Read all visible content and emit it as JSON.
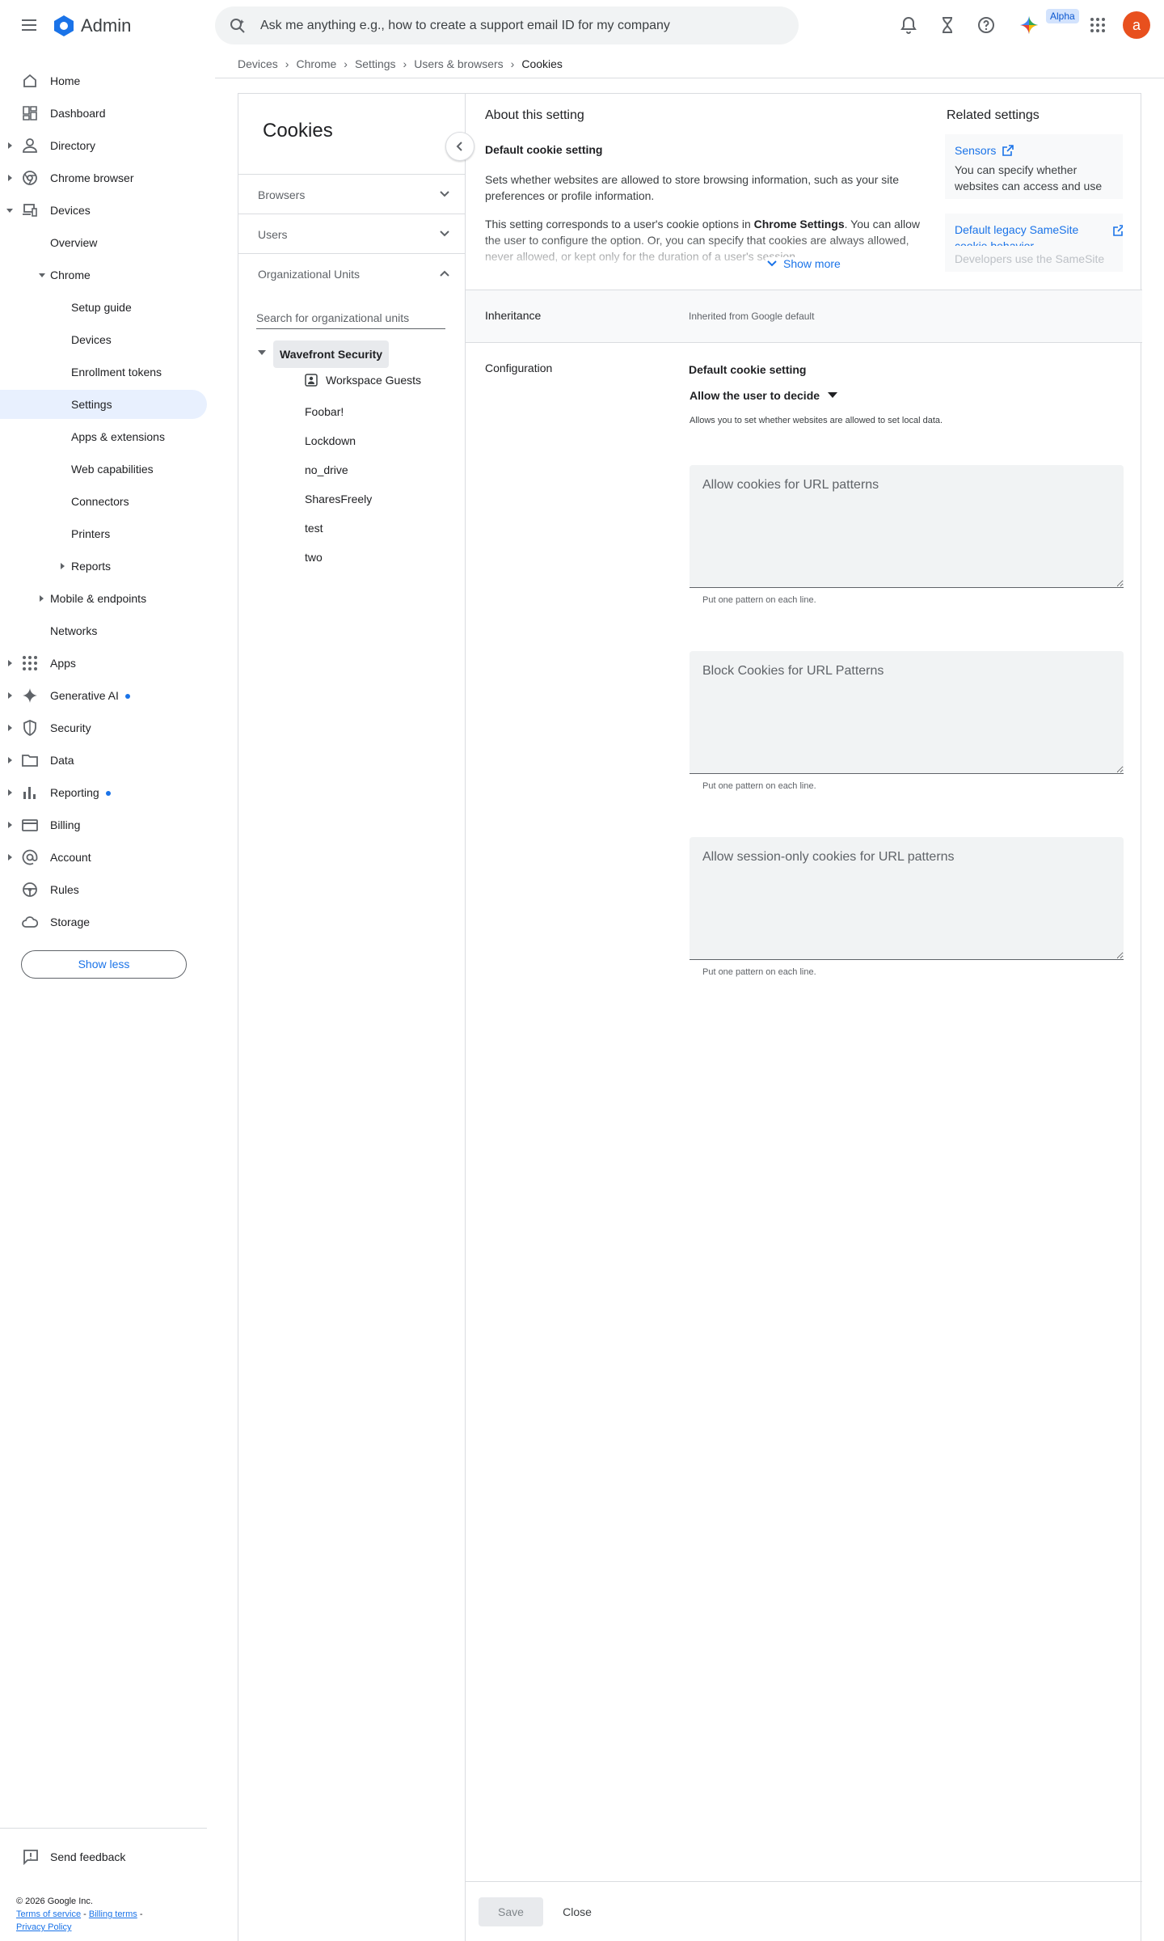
{
  "header": {
    "app_name": "Admin",
    "search_placeholder": "Ask me anything e.g., how to create a support email ID for my company",
    "alpha_badge": "Alpha",
    "avatar_letter": "a",
    "accent_color": "#1a73e8",
    "avatar_color": "#e8501e"
  },
  "breadcrumb": [
    "Devices",
    "Chrome",
    "Settings",
    "Users & browsers",
    "Cookies"
  ],
  "sidebar": {
    "items": [
      {
        "label": "Home"
      },
      {
        "label": "Dashboard"
      },
      {
        "label": "Directory"
      },
      {
        "label": "Chrome browser"
      },
      {
        "label": "Devices"
      },
      {
        "label": "Overview"
      },
      {
        "label": "Chrome"
      },
      {
        "label": "Setup guide"
      },
      {
        "label": "Devices"
      },
      {
        "label": "Enrollment tokens"
      },
      {
        "label": "Settings"
      },
      {
        "label": "Apps & extensions"
      },
      {
        "label": "Web capabilities"
      },
      {
        "label": "Connectors"
      },
      {
        "label": "Printers"
      },
      {
        "label": "Reports"
      },
      {
        "label": "Mobile & endpoints"
      },
      {
        "label": "Networks"
      },
      {
        "label": "Apps"
      },
      {
        "label": "Generative AI"
      },
      {
        "label": "Security"
      },
      {
        "label": "Data"
      },
      {
        "label": "Reporting"
      },
      {
        "label": "Billing"
      },
      {
        "label": "Account"
      },
      {
        "label": "Rules"
      },
      {
        "label": "Storage"
      }
    ],
    "show_less": "Show less",
    "send_feedback": "Send feedback",
    "footer": {
      "copyright": "© 2026 Google Inc.",
      "terms": "Terms of service",
      "billing_terms": "Billing terms",
      "privacy": "Privacy Policy"
    }
  },
  "left_panel": {
    "title": "Cookies",
    "sections": [
      "Browsers",
      "Users",
      "Organizational Units"
    ],
    "ou_search_placeholder": "Search for organizational units",
    "org_units": {
      "root": "Wavefront Security",
      "child_group": "Workspace Guests",
      "children": [
        "Foobar!",
        "Lockdown",
        "no_drive",
        "SharesFreely",
        "test",
        "two"
      ]
    }
  },
  "about": {
    "heading": "About this setting",
    "subheading": "Default cookie setting",
    "para1": "Sets whether websites are allowed to store browsing information, such as your site preferences or profile information.",
    "para2_pre": "This setting corresponds to a user's cookie options in ",
    "para2_bold": "Chrome Settings",
    "para2_post": ". You can allow the user to configure the option. Or, you can specify that cookies are always allowed, never allowed, or kept only for the duration of a user's session.",
    "show_more": "Show more"
  },
  "related": {
    "heading": "Related settings",
    "items": [
      {
        "title": "Sensors",
        "desc": "You can specify whether websites can access and use sensors such as motion or light sensors."
      },
      {
        "title": "Default legacy SameSite cookie behavior",
        "desc": "Developers use the SameSite"
      }
    ]
  },
  "inheritance": {
    "label": "Inheritance",
    "value": "Inherited from Google default"
  },
  "configuration": {
    "label": "Configuration",
    "setting_title": "Default cookie setting",
    "selected": "Allow the user to decide",
    "description": "Allows you to set whether websites are allowed to set local data.",
    "fields": [
      {
        "placeholder": "Allow cookies for URL patterns",
        "helper": "Put one pattern on each line."
      },
      {
        "placeholder": "Block Cookies for URL Patterns",
        "helper": "Put one pattern on each line."
      },
      {
        "placeholder": "Allow session-only cookies for URL patterns",
        "helper": "Put one pattern on each line."
      }
    ]
  },
  "actions": {
    "save": "Save",
    "close": "Close"
  }
}
